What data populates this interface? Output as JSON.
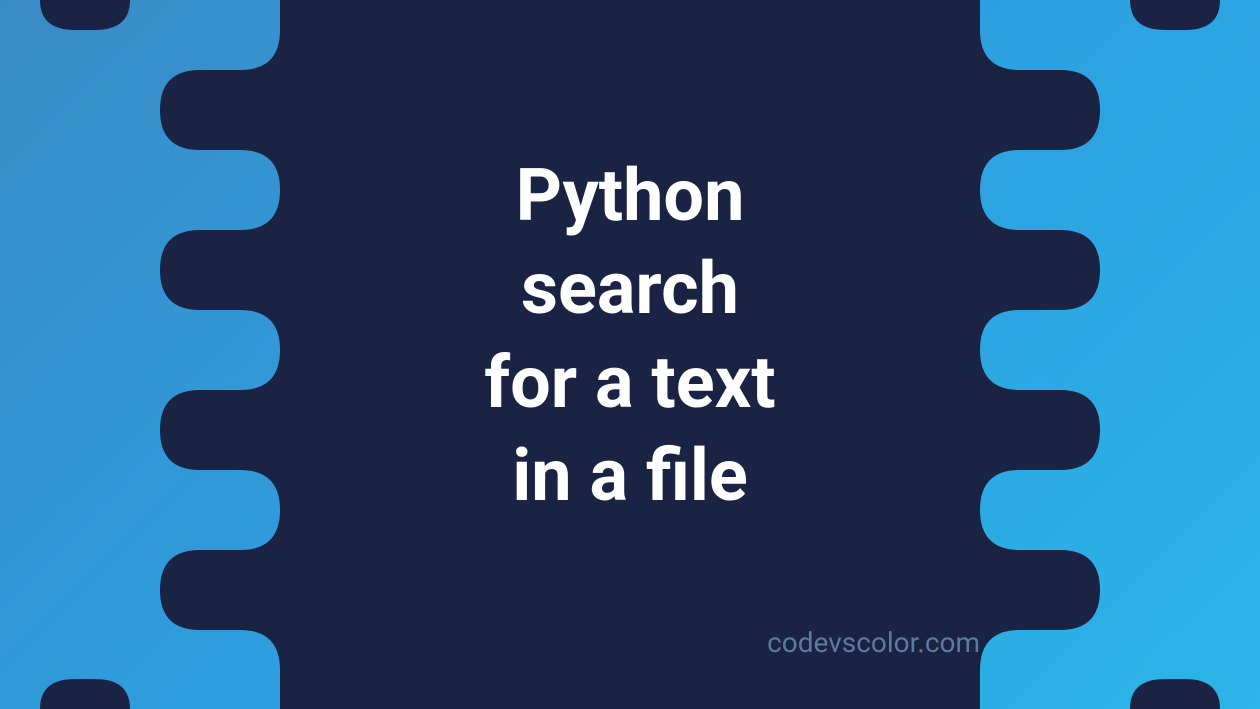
{
  "title": {
    "line1": "Python",
    "line2": "search",
    "line3": "for a text",
    "line4": "in a file"
  },
  "watermark": "codevscolor.com",
  "colors": {
    "dark_bg": "#1a2344",
    "light_blue_left": "#3a8bc5",
    "light_blue_right": "#2cb5e8",
    "text": "#ffffff",
    "watermark_text": "#5b7c9d"
  }
}
